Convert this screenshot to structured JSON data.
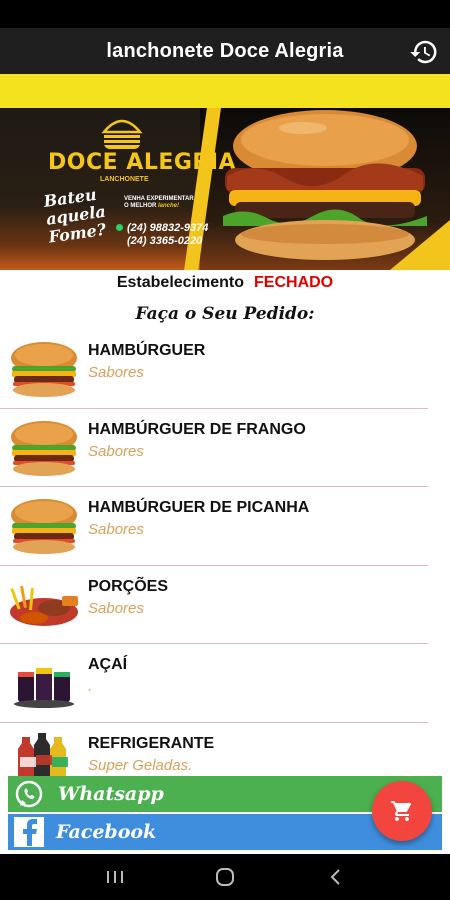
{
  "app": {
    "title": "lanchonete Doce Alegria"
  },
  "icons": {
    "history": "history-icon",
    "cart": "shopping-cart-icon",
    "whatsapp": "whatsapp-icon",
    "facebook": "facebook-icon"
  },
  "banner": {
    "brand": "DOCE ALEGRIA",
    "brand_sub": "LANCHONETE",
    "slogan": "Bateu aquela Fome?",
    "promo_line1": "VENHA EXPERIMENTAR",
    "promo_line2": "O MELHOR",
    "promo_accent": "lanche!",
    "phone1": "(24) 98832-9374",
    "phone2": "(24) 3365-0220"
  },
  "status": {
    "label": "Estabelecimento",
    "value": "FECHADO"
  },
  "order_title": "Faça o Seu Pedido:",
  "menu": [
    {
      "name": "HAMBÚRGUER",
      "subtitle": "Sabores",
      "thumb": "burger"
    },
    {
      "name": "HAMBÚRGUER DE FRANGO",
      "subtitle": "Sabores",
      "thumb": "burger"
    },
    {
      "name": "HAMBÚRGUER DE PICANHA",
      "subtitle": "Sabores",
      "thumb": "burger"
    },
    {
      "name": "PORÇÕES",
      "subtitle": "Sabores",
      "thumb": "portions"
    },
    {
      "name": "AÇAÍ",
      "subtitle": ".",
      "thumb": "acai"
    },
    {
      "name": "REFRIGERANTE",
      "subtitle": "Super Geladas.",
      "thumb": "soda"
    }
  ],
  "social": {
    "whatsapp": "Whatsapp",
    "facebook": "Facebook"
  },
  "colors": {
    "closed": "#e00000",
    "subtitle": "#d7a25a",
    "whatsapp": "#4caf50",
    "facebook": "#3f8ede",
    "fab": "#f2453d",
    "accent_yellow": "#f5e21e"
  }
}
